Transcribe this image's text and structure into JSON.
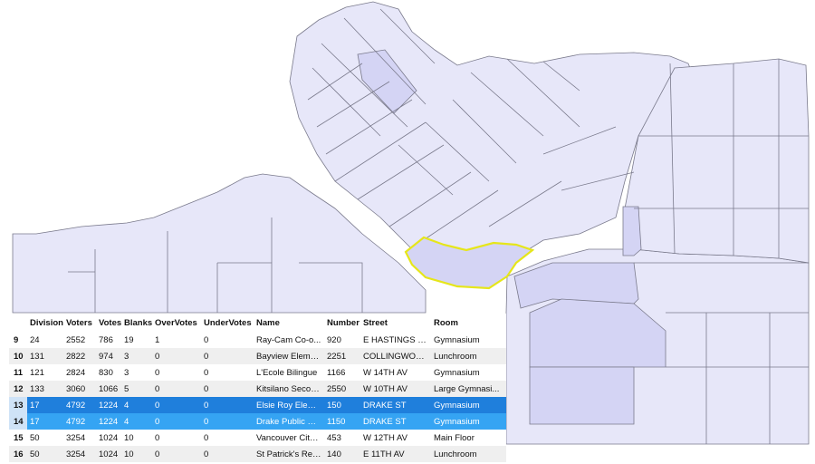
{
  "colors": {
    "polygon_fill": "#e7e7f9",
    "polygon_highlight": "#d4d4f4",
    "polygon_stroke": "#7a7a8c",
    "selection_outline": "#e6e61a",
    "row_selected": "#1f7fdc",
    "row_selected_alt": "#35a4f3"
  },
  "table": {
    "columns": [
      "Division",
      "Voters",
      "Votes",
      "Blanks",
      "OverVotes",
      "UnderVotes",
      "Name",
      "Number",
      "Street",
      "Room"
    ],
    "rows": [
      {
        "row": "9",
        "Division": "24",
        "Voters": "2552",
        "Votes": "786",
        "Blanks": "19",
        "OverVotes": "1",
        "UnderVotes": "0",
        "Name": "Ray-Cam Co-o...",
        "Number": "920",
        "Street": "E HASTINGS ST",
        "Room": "Gymnasium",
        "selected": false
      },
      {
        "row": "10",
        "Division": "131",
        "Voters": "2822",
        "Votes": "974",
        "Blanks": "3",
        "OverVotes": "0",
        "UnderVotes": "0",
        "Name": "Bayview Eleme...",
        "Number": "2251",
        "Street": "COLLINGWOO...",
        "Room": "Lunchroom",
        "selected": false
      },
      {
        "row": "11",
        "Division": "121",
        "Voters": "2824",
        "Votes": "830",
        "Blanks": "3",
        "OverVotes": "0",
        "UnderVotes": "0",
        "Name": "L'Ecole Bilingue",
        "Number": "1166",
        "Street": "W 14TH AV",
        "Room": "Gymnasium",
        "selected": false
      },
      {
        "row": "12",
        "Division": "133",
        "Voters": "3060",
        "Votes": "1066",
        "Blanks": "5",
        "OverVotes": "0",
        "UnderVotes": "0",
        "Name": "Kitsilano Secon...",
        "Number": "2550",
        "Street": "W 10TH AV",
        "Room": "Large Gymnasi...",
        "selected": false
      },
      {
        "row": "13",
        "Division": "17",
        "Voters": "4792",
        "Votes": "1224",
        "Blanks": "4",
        "OverVotes": "0",
        "UnderVotes": "0",
        "Name": "Elsie Roy Eleme...",
        "Number": "150",
        "Street": "DRAKE ST",
        "Room": "Gymnasium",
        "selected": true
      },
      {
        "row": "14",
        "Division": "17",
        "Voters": "4792",
        "Votes": "1224",
        "Blanks": "4",
        "OverVotes": "0",
        "UnderVotes": "0",
        "Name": "Drake Public Sc...",
        "Number": "1150",
        "Street": "DRAKE ST",
        "Room": "Gymnasium",
        "selected": true
      },
      {
        "row": "15",
        "Division": "50",
        "Voters": "3254",
        "Votes": "1024",
        "Blanks": "10",
        "OverVotes": "0",
        "UnderVotes": "0",
        "Name": "Vancouver City ...",
        "Number": "453",
        "Street": "W 12TH AV",
        "Room": "Main Floor",
        "selected": false
      },
      {
        "row": "16",
        "Division": "50",
        "Voters": "3254",
        "Votes": "1024",
        "Blanks": "10",
        "OverVotes": "0",
        "UnderVotes": "0",
        "Name": "St Patrick's Regi...",
        "Number": "140",
        "Street": "E 11TH AV",
        "Room": "Lunchroom",
        "selected": false
      }
    ]
  }
}
